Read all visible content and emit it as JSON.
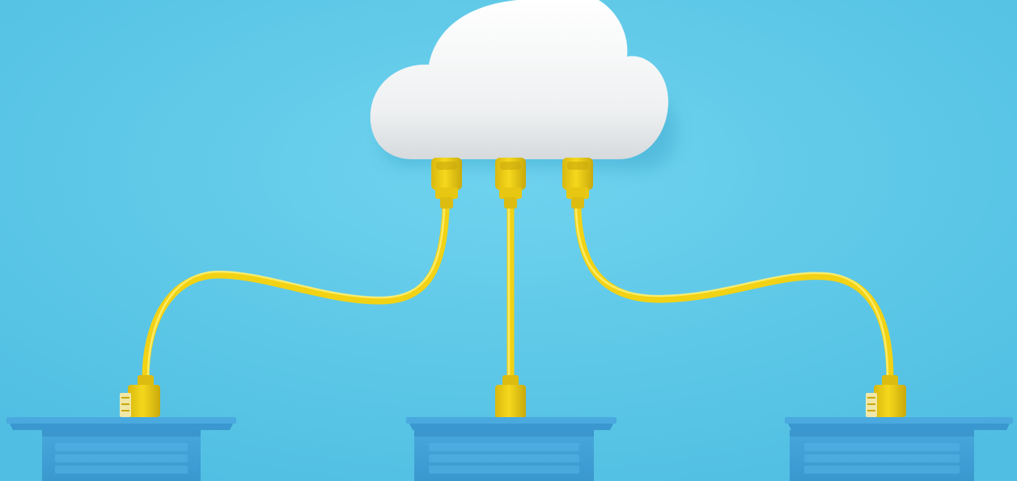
{
  "scene": {
    "subject": "cloud-network",
    "colors": {
      "background": "#5ac8e8",
      "background_light": "#6fd3ee",
      "background_dark": "#49b7da",
      "cloud": "#f4f4f4",
      "cloud_shade": "#d9dde0",
      "cable": "#f2d214",
      "cable_dark": "#c9a90c",
      "laptop": "#3f9fd6",
      "laptop_dark": "#2f86bd",
      "laptop_key": "#4dadE2"
    },
    "icons": [
      "cloud-icon",
      "ethernet-plug-icon",
      "laptop-icon"
    ]
  }
}
